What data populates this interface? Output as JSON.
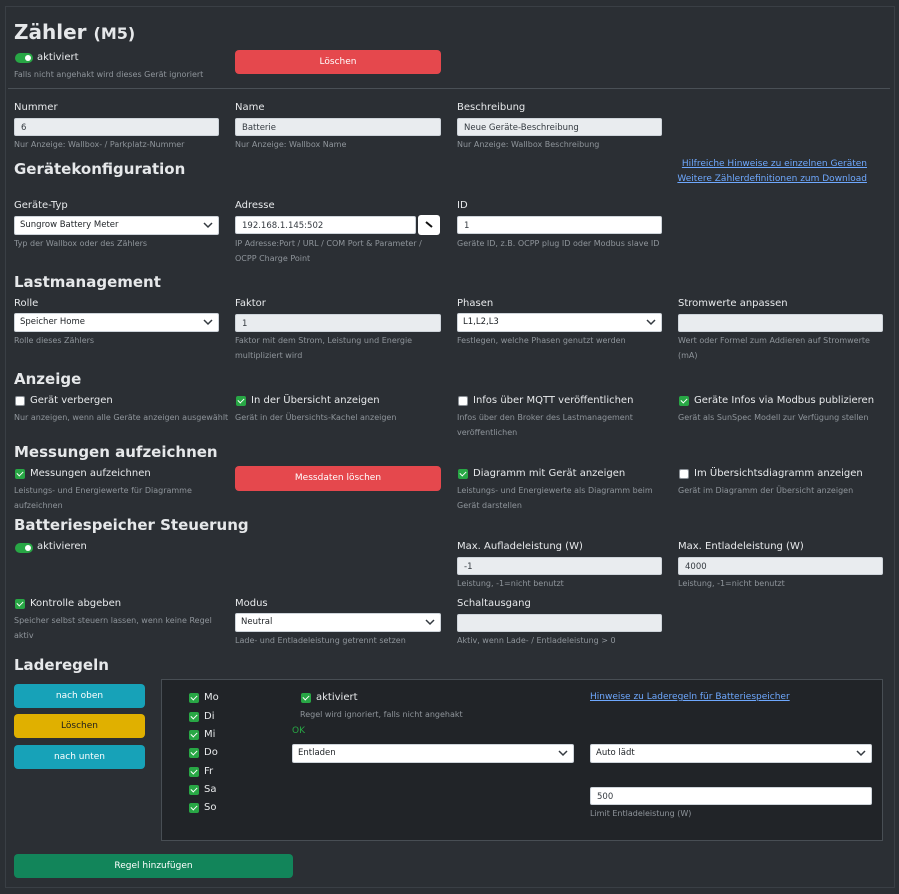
{
  "header": {
    "title": "Zähler",
    "title_suffix": "(M5)",
    "active_label": "aktiviert",
    "active_hint": "Falls nicht angehakt wird dieses Gerät ignoriert",
    "delete_button": "Löschen"
  },
  "basic": {
    "nummer": {
      "label": "Nummer",
      "value": "6",
      "hint": "Nur Anzeige: Wallbox- / Parkplatz-Nummer"
    },
    "name": {
      "label": "Name",
      "value": "Batterie",
      "hint": "Nur Anzeige: Wallbox Name"
    },
    "beschreibung": {
      "label": "Beschreibung",
      "value": "Neue Geräte-Beschreibung",
      "hint": "Nur Anzeige: Wallbox Beschreibung"
    }
  },
  "geraetekonfig": {
    "heading": "Gerätekonfiguration",
    "link1": "Hilfreiche Hinweise zu einzelnen Geräten",
    "link2": "Weitere Zählerdefinitionen zum Download",
    "typ": {
      "label": "Geräte-Typ",
      "value": "Sungrow Battery Meter",
      "hint": "Typ der Wallbox oder des Zählers"
    },
    "adresse": {
      "label": "Adresse",
      "value": "192.168.1.145:502",
      "hint1": "IP Adresse:Port / URL / COM Port & Parameter /",
      "hint2": "OCPP Charge Point"
    },
    "id": {
      "label": "ID",
      "value": "1",
      "hint": "Geräte ID, z.B. OCPP plug ID oder Modbus slave ID"
    }
  },
  "lastmanagement": {
    "heading": "Lastmanagement",
    "rolle": {
      "label": "Rolle",
      "value": "Speicher Home",
      "hint": "Rolle dieses Zählers"
    },
    "faktor": {
      "label": "Faktor",
      "value": "1",
      "hint1": "Faktor mit dem Strom, Leistung und Energie",
      "hint2": "multipliziert wird"
    },
    "phasen": {
      "label": "Phasen",
      "value": "L1,L2,L3",
      "hint": "Festlegen, welche Phasen genutzt werden"
    },
    "strom": {
      "label": "Stromwerte anpassen",
      "value": "",
      "hint1": "Wert oder Formel zum Addieren auf Stromwerte",
      "hint2": "(mA)"
    }
  },
  "anzeige": {
    "heading": "Anzeige",
    "c1": {
      "label": "Gerät verbergen",
      "hint": "Nur anzeigen, wenn alle Geräte anzeigen ausgewählt"
    },
    "c2": {
      "label": "In der Übersicht anzeigen",
      "hint": "Gerät in der Übersichts-Kachel anzeigen"
    },
    "c3": {
      "label": "Infos über MQTT veröffentlichen",
      "hint1": "Infos über den Broker des Lastmanagement",
      "hint2": "veröffentlichen"
    },
    "c4": {
      "label": "Geräte Infos via Modbus publizieren",
      "hint": "Gerät als SunSpec Modell zur Verfügung stellen"
    }
  },
  "messungen": {
    "heading": "Messungen aufzeichnen",
    "c1": {
      "label": "Messungen aufzeichnen",
      "hint1": "Leistungs- und Energiewerte für Diagramme",
      "hint2": "aufzeichnen"
    },
    "button": "Messdaten löschen",
    "c2": {
      "label": "Diagramm mit Gerät anzeigen",
      "hint1": "Leistungs- und Energiewerte als Diagramm beim",
      "hint2": "Gerät darstellen"
    },
    "c3": {
      "label": "Im Übersichtsdiagramm anzeigen",
      "hint": "Gerät im Diagramm der Übersicht anzeigen"
    }
  },
  "batterie": {
    "heading": "Batteriespeicher Steuerung",
    "aktivieren": "aktivieren",
    "auflade": {
      "label": "Max. Aufladeleistung (W)",
      "value": "-1",
      "hint": "Leistung, -1=nicht benutzt"
    },
    "entlade": {
      "label": "Max. Entladeleistung (W)",
      "value": "4000",
      "hint": "Leistung, -1=nicht benutzt"
    },
    "kontrolle": {
      "label": "Kontrolle abgeben",
      "hint1": "Speicher selbst steuern lassen, wenn keine Regel",
      "hint2": "aktiv"
    },
    "modus": {
      "label": "Modus",
      "value": "Neutral",
      "hint": "Lade- und Entladeleistung getrennt setzen"
    },
    "schalt": {
      "label": "Schaltausgang",
      "value": "",
      "hint": "Aktiv, wenn Lade- / Entladeleistung > 0"
    }
  },
  "laderegeln": {
    "heading": "Laderegeln",
    "btn_up": "nach oben",
    "btn_delete": "Löschen",
    "btn_down": "nach unten",
    "days": [
      "Mo",
      "Di",
      "Mi",
      "Do",
      "Fr",
      "Sa",
      "So"
    ],
    "aktiviert": "aktiviert",
    "aktiviert_hint": "Regel wird ignoriert, falls nicht angehakt",
    "ok": "OK",
    "link": "Hinweise zu Laderegeln für Batteriespeicher",
    "select1": "Entladen",
    "select2": "Auto lädt",
    "limit_value": "500",
    "limit_hint": "Limit Entladeleistung (W)",
    "add_button": "Regel hinzufügen"
  },
  "colors": {
    "bg": "#2b2f34",
    "red": "#e5484d",
    "teal": "#17a2b8",
    "yellow": "#e0b000",
    "green": "#12855a",
    "check": "#28a745",
    "link": "#6ea8fe"
  }
}
